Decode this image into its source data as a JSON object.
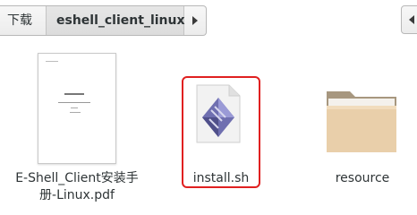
{
  "pathbar": {
    "crumbs": [
      "下载",
      "eshell_client_linux"
    ],
    "active_index": 1
  },
  "files": [
    {
      "name_line1": "E-Shell_Client安装手",
      "name_line2": "册-Linux.pdf",
      "icon": "pdf-document-thumbnail-icon"
    },
    {
      "name_line1": "install.sh",
      "icon": "shell-script-icon",
      "highlighted": true
    },
    {
      "name_line1": "resource",
      "icon": "folder-icon"
    }
  ],
  "colors": {
    "highlight_border": "#e02020",
    "folder_body": "#e9cfaa",
    "folder_back": "#a7977f",
    "script_gem": "#6f6fb0"
  }
}
